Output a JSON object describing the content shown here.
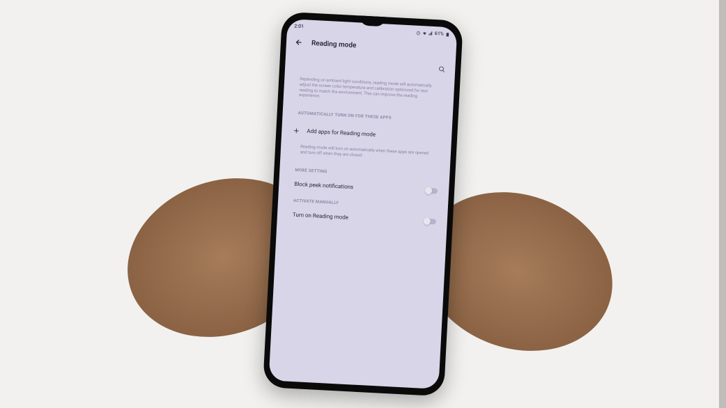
{
  "status_bar": {
    "time": "2:01",
    "battery": "61%"
  },
  "header": {
    "title": "Reading mode"
  },
  "description": "Depending on ambient light conditions, reading mode will automatically adjust the screen color temperature and calibration optimized for text reading to match the environment. This can improve the reading experience.",
  "sections": {
    "auto_apps": {
      "header": "AUTOMATICALLY TURN ON FOR THESE APPS",
      "add_label": "Add apps for Reading mode",
      "note": "Reading mode will turn on automatically when these apps are opened and turn off when they are closed."
    },
    "more_setting": {
      "header": "MORE SETTING",
      "block_peek_label": "Block peek notifications"
    },
    "activate_manually": {
      "header": "ACTIVATE MANUALLY",
      "turn_on_label": "Turn on Reading mode"
    }
  }
}
